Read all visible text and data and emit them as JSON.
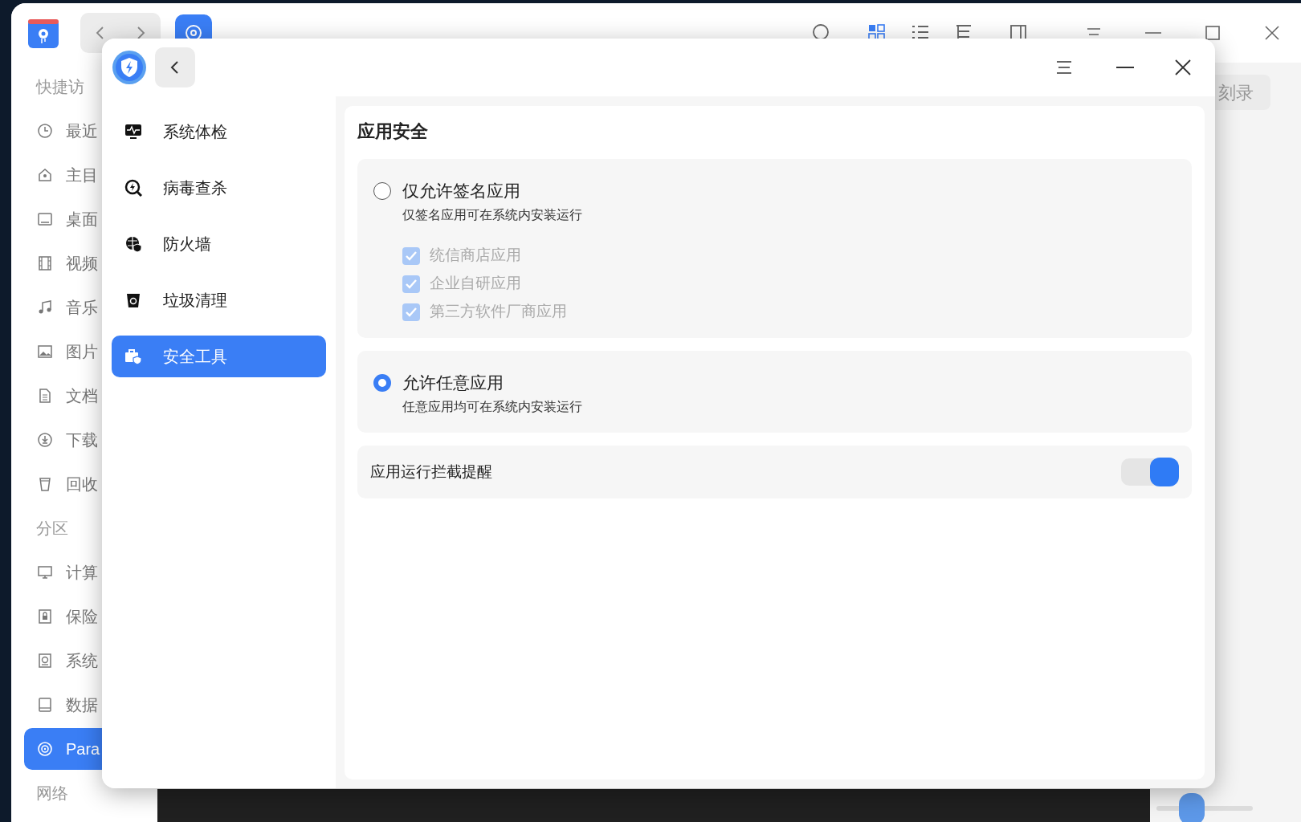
{
  "file_manager": {
    "sidebar": [
      {
        "kind": "heading",
        "label": "快捷访"
      },
      {
        "kind": "item",
        "label": "最近",
        "selected": false
      },
      {
        "kind": "item",
        "label": "主目",
        "selected": false
      },
      {
        "kind": "item",
        "label": "桌面",
        "selected": false
      },
      {
        "kind": "item",
        "label": "视频",
        "selected": false
      },
      {
        "kind": "item",
        "label": "音乐",
        "selected": false
      },
      {
        "kind": "item",
        "label": "图片",
        "selected": false
      },
      {
        "kind": "item",
        "label": "文档",
        "selected": false
      },
      {
        "kind": "item",
        "label": "下载",
        "selected": false
      },
      {
        "kind": "item",
        "label": "回收",
        "selected": false
      },
      {
        "kind": "heading",
        "label": "分区"
      },
      {
        "kind": "item",
        "label": "计算",
        "selected": false
      },
      {
        "kind": "item",
        "label": "保险",
        "selected": false
      },
      {
        "kind": "item",
        "label": "系统",
        "selected": false
      },
      {
        "kind": "item",
        "label": "数据",
        "selected": false
      },
      {
        "kind": "item",
        "label": "Para",
        "selected": true
      },
      {
        "kind": "heading",
        "label": "网络"
      }
    ],
    "burn_button": "刻录"
  },
  "dialog": {
    "menu": [
      {
        "label": "系统体检",
        "selected": false
      },
      {
        "label": "病毒查杀",
        "selected": false
      },
      {
        "label": "防火墙",
        "selected": false
      },
      {
        "label": "垃圾清理",
        "selected": false
      },
      {
        "label": "安全工具",
        "selected": true
      }
    ],
    "section_title": "应用安全",
    "options": [
      {
        "label": "仅允许签名应用",
        "description": "仅签名应用可在系统内安装运行",
        "selected": false,
        "sub_options": [
          {
            "label": "统信商店应用",
            "checked": true,
            "disabled": true
          },
          {
            "label": "企业自研应用",
            "checked": true,
            "disabled": true
          },
          {
            "label": "第三方软件厂商应用",
            "checked": true,
            "disabled": true
          }
        ]
      },
      {
        "label": "允许任意应用",
        "description": "任意应用均可在系统内安装运行",
        "selected": true
      }
    ],
    "toggle": {
      "label": "应用运行拦截提醒",
      "on": true
    }
  }
}
